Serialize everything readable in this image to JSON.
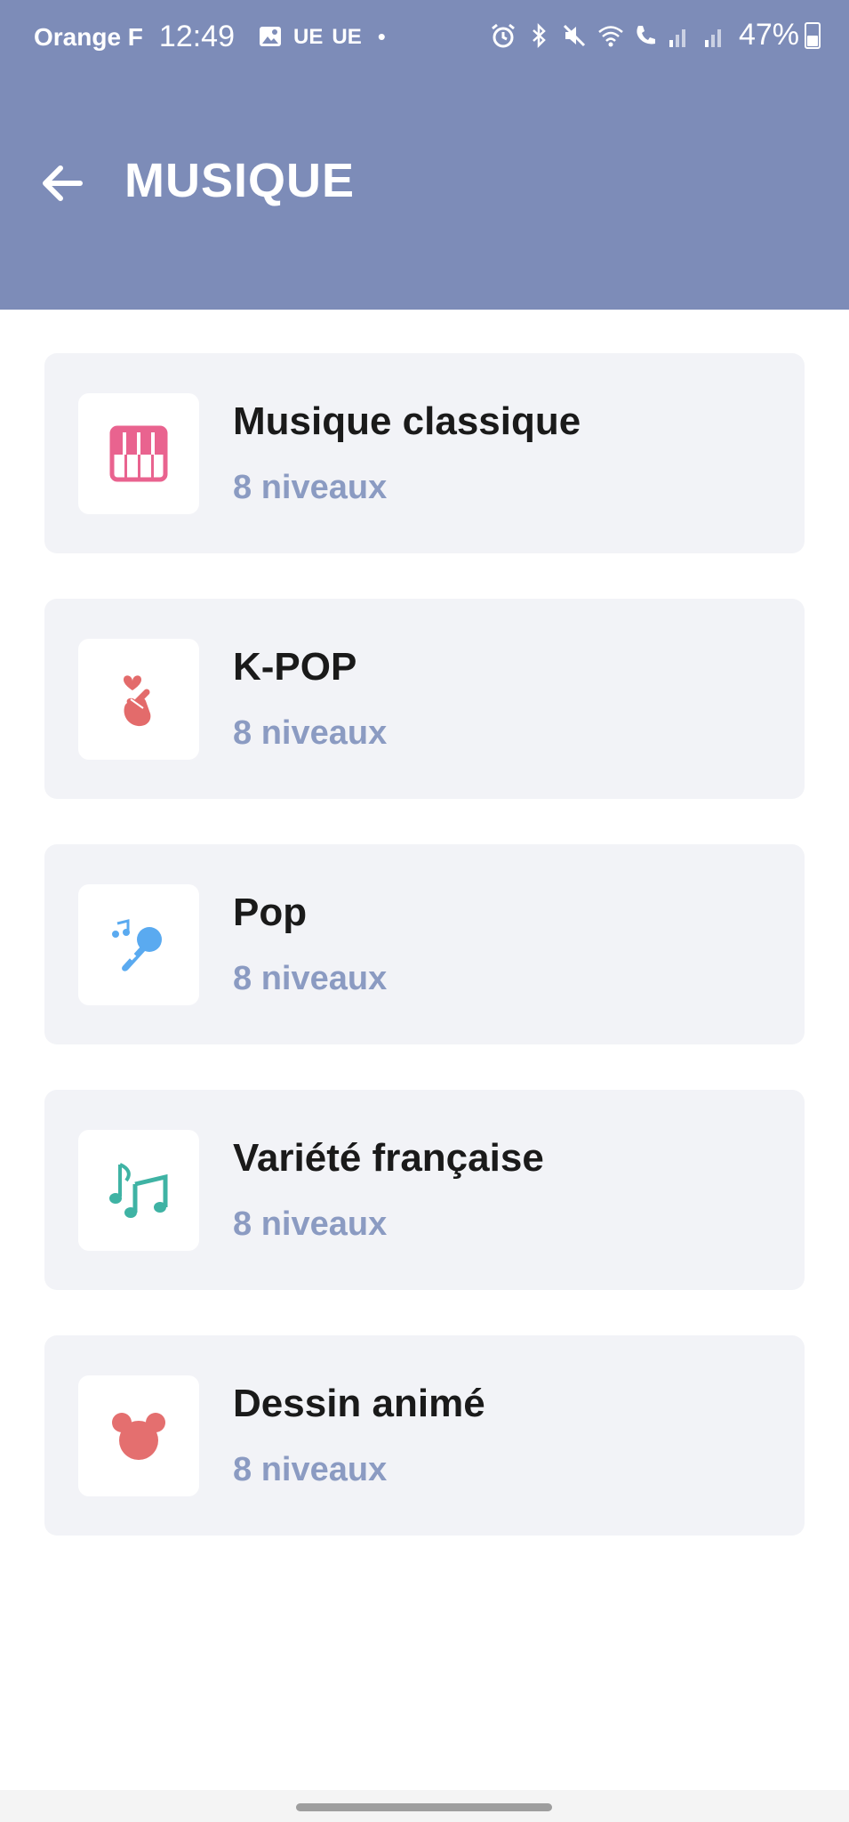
{
  "statusbar": {
    "carrier": "Orange F",
    "time": "12:49",
    "ue1": "UE",
    "ue2": "UE",
    "dot": "•",
    "battery": "47%"
  },
  "header": {
    "title": "MUSIQUE",
    "back_icon": "arrow-left-icon"
  },
  "categories": [
    {
      "title": "Musique classique",
      "subtitle": "8 niveaux",
      "icon": "piano-icon",
      "color": "#e9638f"
    },
    {
      "title": "K-POP",
      "subtitle": "8 niveaux",
      "icon": "finger-heart-icon",
      "color": "#e36b6b"
    },
    {
      "title": "Pop",
      "subtitle": "8 niveaux",
      "icon": "microphone-icon",
      "color": "#5aaaf0"
    },
    {
      "title": "Variété française",
      "subtitle": "8 niveaux",
      "icon": "music-notes-icon",
      "color": "#3fb3a4"
    },
    {
      "title": "Dessin animé",
      "subtitle": "8 niveaux",
      "icon": "mouse-head-icon",
      "color": "#e46f6f"
    }
  ],
  "colors": {
    "header_bg": "#7d8cb8",
    "card_bg": "#f2f3f7",
    "subtitle": "#8b9bc2"
  }
}
